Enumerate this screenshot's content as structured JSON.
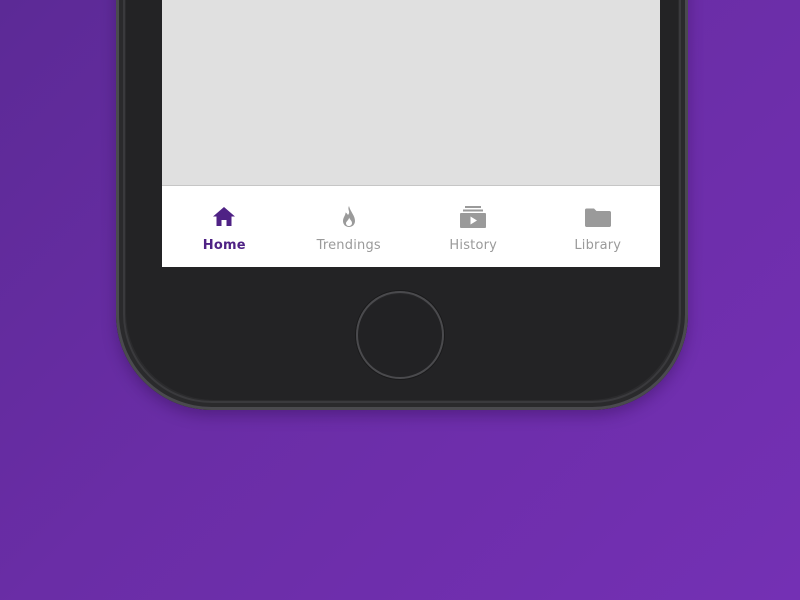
{
  "colors": {
    "background_start": "#5c2a96",
    "background_end": "#7430b4",
    "active_tab": "#4f2285",
    "inactive_tab": "#9a9a9a",
    "tabbar_background": "#ffffff",
    "screen_background": "#e0e0e0"
  },
  "tabbar": {
    "active_index": 0,
    "tabs": [
      {
        "label": "Home",
        "icon": "home-icon",
        "active": true
      },
      {
        "label": "Trendings",
        "icon": "flame-icon",
        "active": false
      },
      {
        "label": "History",
        "icon": "history-video-icon",
        "active": false
      },
      {
        "label": "Library",
        "icon": "folder-icon",
        "active": false
      }
    ]
  }
}
